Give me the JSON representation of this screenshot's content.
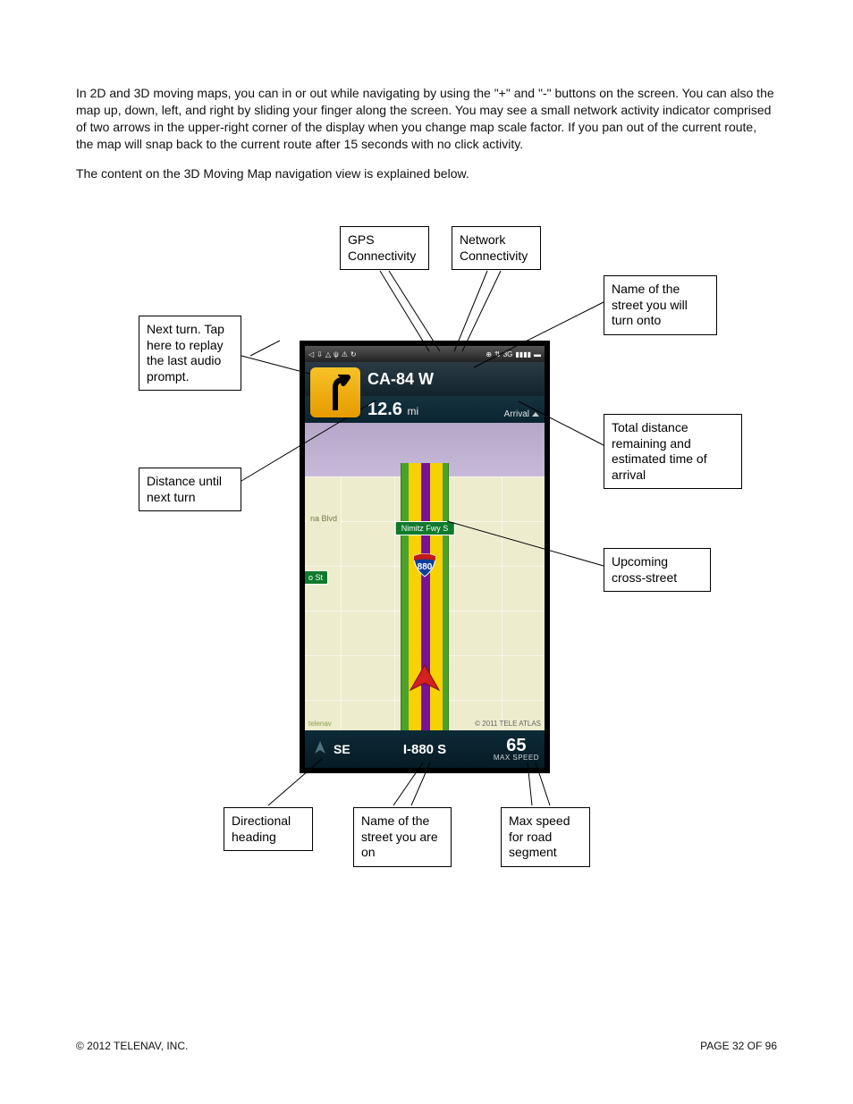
{
  "paragraph1": "In 2D and 3D moving maps, you can          in or out while navigating by using the \"+\" and \"-\" buttons on the screen. You can also        the map up, down, left, and right by sliding your finger along the screen. You may see a small network activity indicator comprised of two arrows in the upper-right corner of the display when you change map scale factor. If you pan out of the current route, the map will snap back to the current route after 15 seconds with no click activity.",
  "paragraph2": "The content on the 3D Moving Map navigation view is explained below.",
  "callouts": {
    "gps": "GPS Connectivity",
    "network": "Network Connectivity",
    "next_turn": "Next turn. Tap here to replay the last audio prompt.",
    "street_onto": "Name of the street you will turn onto",
    "distance_turn": "Distance until next turn",
    "total_eta": "Total distance remaining and estimated time of arrival",
    "upcoming_cross": "Upcoming cross-street",
    "directional": "Directional heading",
    "current_street": "Name of the street you are on",
    "max_speed": "Max speed for road segment"
  },
  "phone": {
    "header": {
      "next_turn_street": "CA-84 W",
      "distance_value": "12.6",
      "distance_unit": "mi",
      "arrival_label": "Arrival"
    },
    "map": {
      "cross_street_sign": "Nimitz Fwy S",
      "interstate_shield": "880",
      "side_sign": "o St",
      "blvd_sign": "na Blvd",
      "attribution_left": "telenav",
      "attribution_right": "© 2011 TELE ATLAS"
    },
    "footer": {
      "heading": "SE",
      "current_street": "I-880 S",
      "max_speed_value": "65",
      "max_speed_label": "MAX SPEED"
    }
  },
  "footer": {
    "copyright": "© 2012 TELENAV, INC.",
    "page": "PAGE 32 OF 96"
  }
}
